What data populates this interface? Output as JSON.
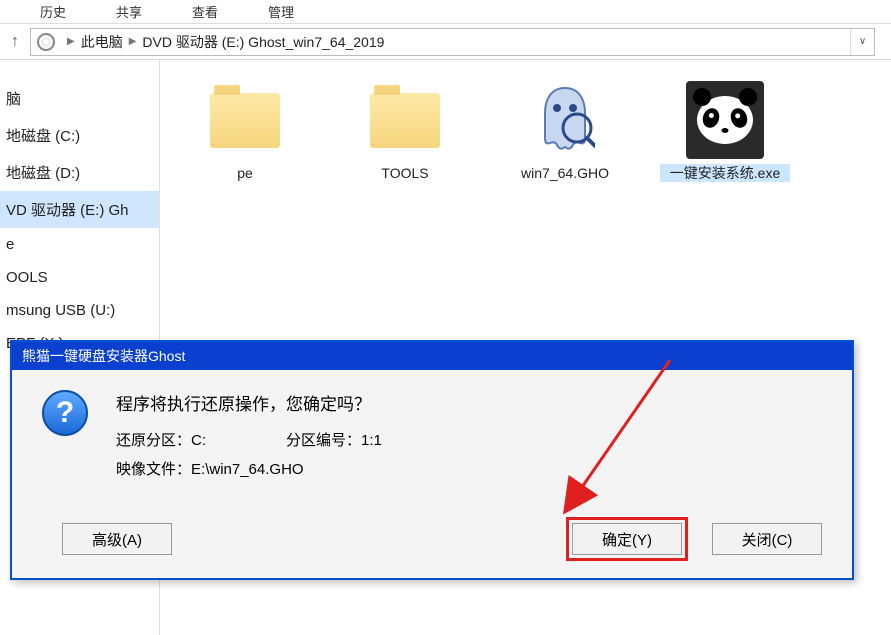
{
  "tabs": {
    "t1": "历史",
    "t2": "共享",
    "t3": "查看",
    "t4": "管理"
  },
  "breadcrumb": {
    "b1": "此电脑",
    "b2": "DVD 驱动器 (E:) Ghost_win7_64_2019"
  },
  "sidebar": {
    "items": [
      {
        "label": "脑"
      },
      {
        "label": "地磁盘 (C:)"
      },
      {
        "label": "地磁盘 (D:)"
      },
      {
        "label": "VD 驱动器 (E:) Gh"
      },
      {
        "label": "e"
      },
      {
        "label": "OOLS"
      },
      {
        "label": "msung USB (U:)"
      },
      {
        "label": "EPF (X:)"
      }
    ]
  },
  "files": {
    "f0": {
      "name": "pe"
    },
    "f1": {
      "name": "TOOLS"
    },
    "f2": {
      "name": "win7_64.GHO"
    },
    "f3": {
      "name": "一键安装系统.exe"
    }
  },
  "dialog": {
    "title": "熊猫一键硬盘安装器Ghost",
    "question_mark": "?",
    "message": "程序将执行还原操作，您确定吗？",
    "partition_label": "还原分区：",
    "partition_value": "C:",
    "partition_num_label": "分区编号：",
    "partition_num_value": "1:1",
    "image_label": "映像文件：",
    "image_value": "E:\\win7_64.GHO",
    "btn_advanced": "高级(A)",
    "btn_ok": "确定(Y)",
    "btn_close": "关闭(C)"
  }
}
